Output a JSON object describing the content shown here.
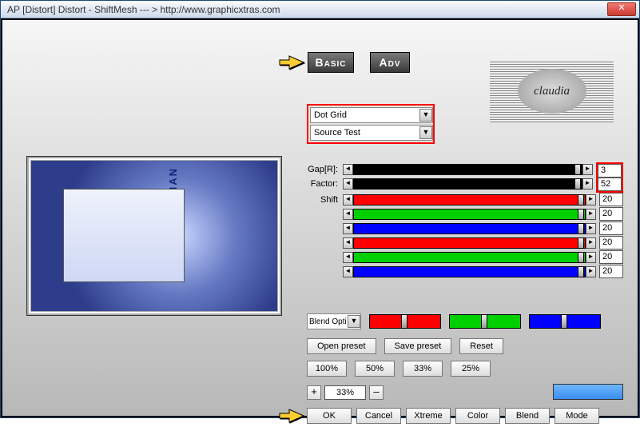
{
  "window": {
    "title": "AP [Distort]  Distort - ShiftMesh    --- > http://www.graphicxtras.com"
  },
  "tabs": {
    "basic": "Basic",
    "adv": "Adv"
  },
  "logo": {
    "text": "claudia"
  },
  "combos": {
    "c1": "Dot Grid",
    "c2": "Source Test"
  },
  "preview": {
    "overlay": "JUST A WOMAN"
  },
  "sliders": {
    "gap": {
      "label": "Gap[R]:",
      "value": "3",
      "color": "#000000",
      "fillcolor": "#000000"
    },
    "factor": {
      "label": "Factor:",
      "value": "52",
      "color": "#000000",
      "fillcolor": "#000000"
    },
    "shift": {
      "label": "Shift",
      "value": "20",
      "color": "#ff0000",
      "fillcolor": "#ff0000"
    },
    "s4": {
      "label": "",
      "value": "20",
      "color": "#00d000",
      "fillcolor": "#00d000"
    },
    "s5": {
      "label": "",
      "value": "20",
      "color": "#0000ff",
      "fillcolor": "#0000ff"
    },
    "s6": {
      "label": "",
      "value": "20",
      "color": "#ff0000",
      "fillcolor": "#ff0000"
    },
    "s7": {
      "label": "",
      "value": "20",
      "color": "#00d000",
      "fillcolor": "#00d000"
    },
    "s8": {
      "label": "",
      "value": "20",
      "color": "#0000ff",
      "fillcolor": "#0000ff"
    }
  },
  "blend": {
    "label": "Blend Opti"
  },
  "rgb_colors": {
    "r": "#ff0000",
    "g": "#00d000",
    "b": "#0000ff"
  },
  "buttons": {
    "open_preset": "Open preset",
    "save_preset": "Save preset",
    "reset": "Reset",
    "p100": "100%",
    "p50": "50%",
    "p33": "33%",
    "p25": "25%",
    "plus": "+",
    "minus": "–",
    "zoom": "33%",
    "ok": "OK",
    "cancel": "Cancel",
    "xtreme": "Xtreme",
    "color": "Color",
    "blendb": "Blend",
    "mode": "Mode"
  }
}
